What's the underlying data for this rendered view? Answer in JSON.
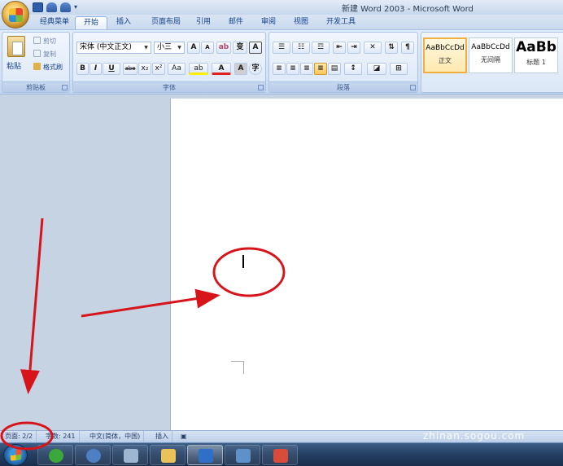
{
  "window": {
    "title": "新建 Word 2003 - Microsoft Word"
  },
  "quick_access": {
    "icons": [
      "save-icon",
      "undo-icon",
      "redo-icon",
      "customize-icon"
    ]
  },
  "tabs": [
    {
      "label": "经典菜单"
    },
    {
      "label": "开始",
      "active": true
    },
    {
      "label": "插入"
    },
    {
      "label": "页面布局"
    },
    {
      "label": "引用"
    },
    {
      "label": "邮件"
    },
    {
      "label": "审阅"
    },
    {
      "label": "视图"
    },
    {
      "label": "开发工具"
    }
  ],
  "ribbon": {
    "clipboard": {
      "label": "剪贴板",
      "paste": "粘贴",
      "cut": "剪切",
      "copy": "复制",
      "format_painter": "格式刷"
    },
    "font": {
      "label": "字体",
      "font_name": "宋体 (中文正文)",
      "font_size": "小三",
      "grow": "A",
      "shrink": "A",
      "clear": "ab",
      "phonetic": "变",
      "border_char": "A",
      "bold": "B",
      "italic": "I",
      "underline": "U",
      "strike": "abe",
      "subscript": "x₂",
      "superscript": "x²",
      "change_case": "Aa",
      "highlight": "ab",
      "font_color": "A",
      "shade_char": "A",
      "enclose_char": "字"
    },
    "paragraph": {
      "label": "段落"
    },
    "styles": [
      {
        "sample": "AaBbCcDd",
        "name": "正文",
        "selected": true
      },
      {
        "sample": "AaBbCcDd",
        "name": "无间隔",
        "selected": false
      },
      {
        "sample": "AaBb",
        "name": "标题 1",
        "selected": false
      }
    ]
  },
  "statusbar": {
    "page": "页面: 2/2",
    "words": "字数: 241",
    "language": "中文(简体，中国)",
    "mode": "插入"
  },
  "taskbar": {
    "items": [
      {
        "name": "ie",
        "color": "#3aa83a"
      },
      {
        "name": "media-player",
        "color": "#4d7fc2"
      },
      {
        "name": "notes",
        "color": "#9fb6d3"
      },
      {
        "name": "explorer",
        "color": "#e9c25a"
      },
      {
        "name": "word",
        "color": "#2e6fc8",
        "active": true
      },
      {
        "name": "screenshot",
        "color": "#5f91c9"
      },
      {
        "name": "app",
        "color": "#d94b3b"
      }
    ]
  },
  "watermark": {
    "cn": "搜狗指南",
    "url": "zhinan.sogou.com"
  }
}
